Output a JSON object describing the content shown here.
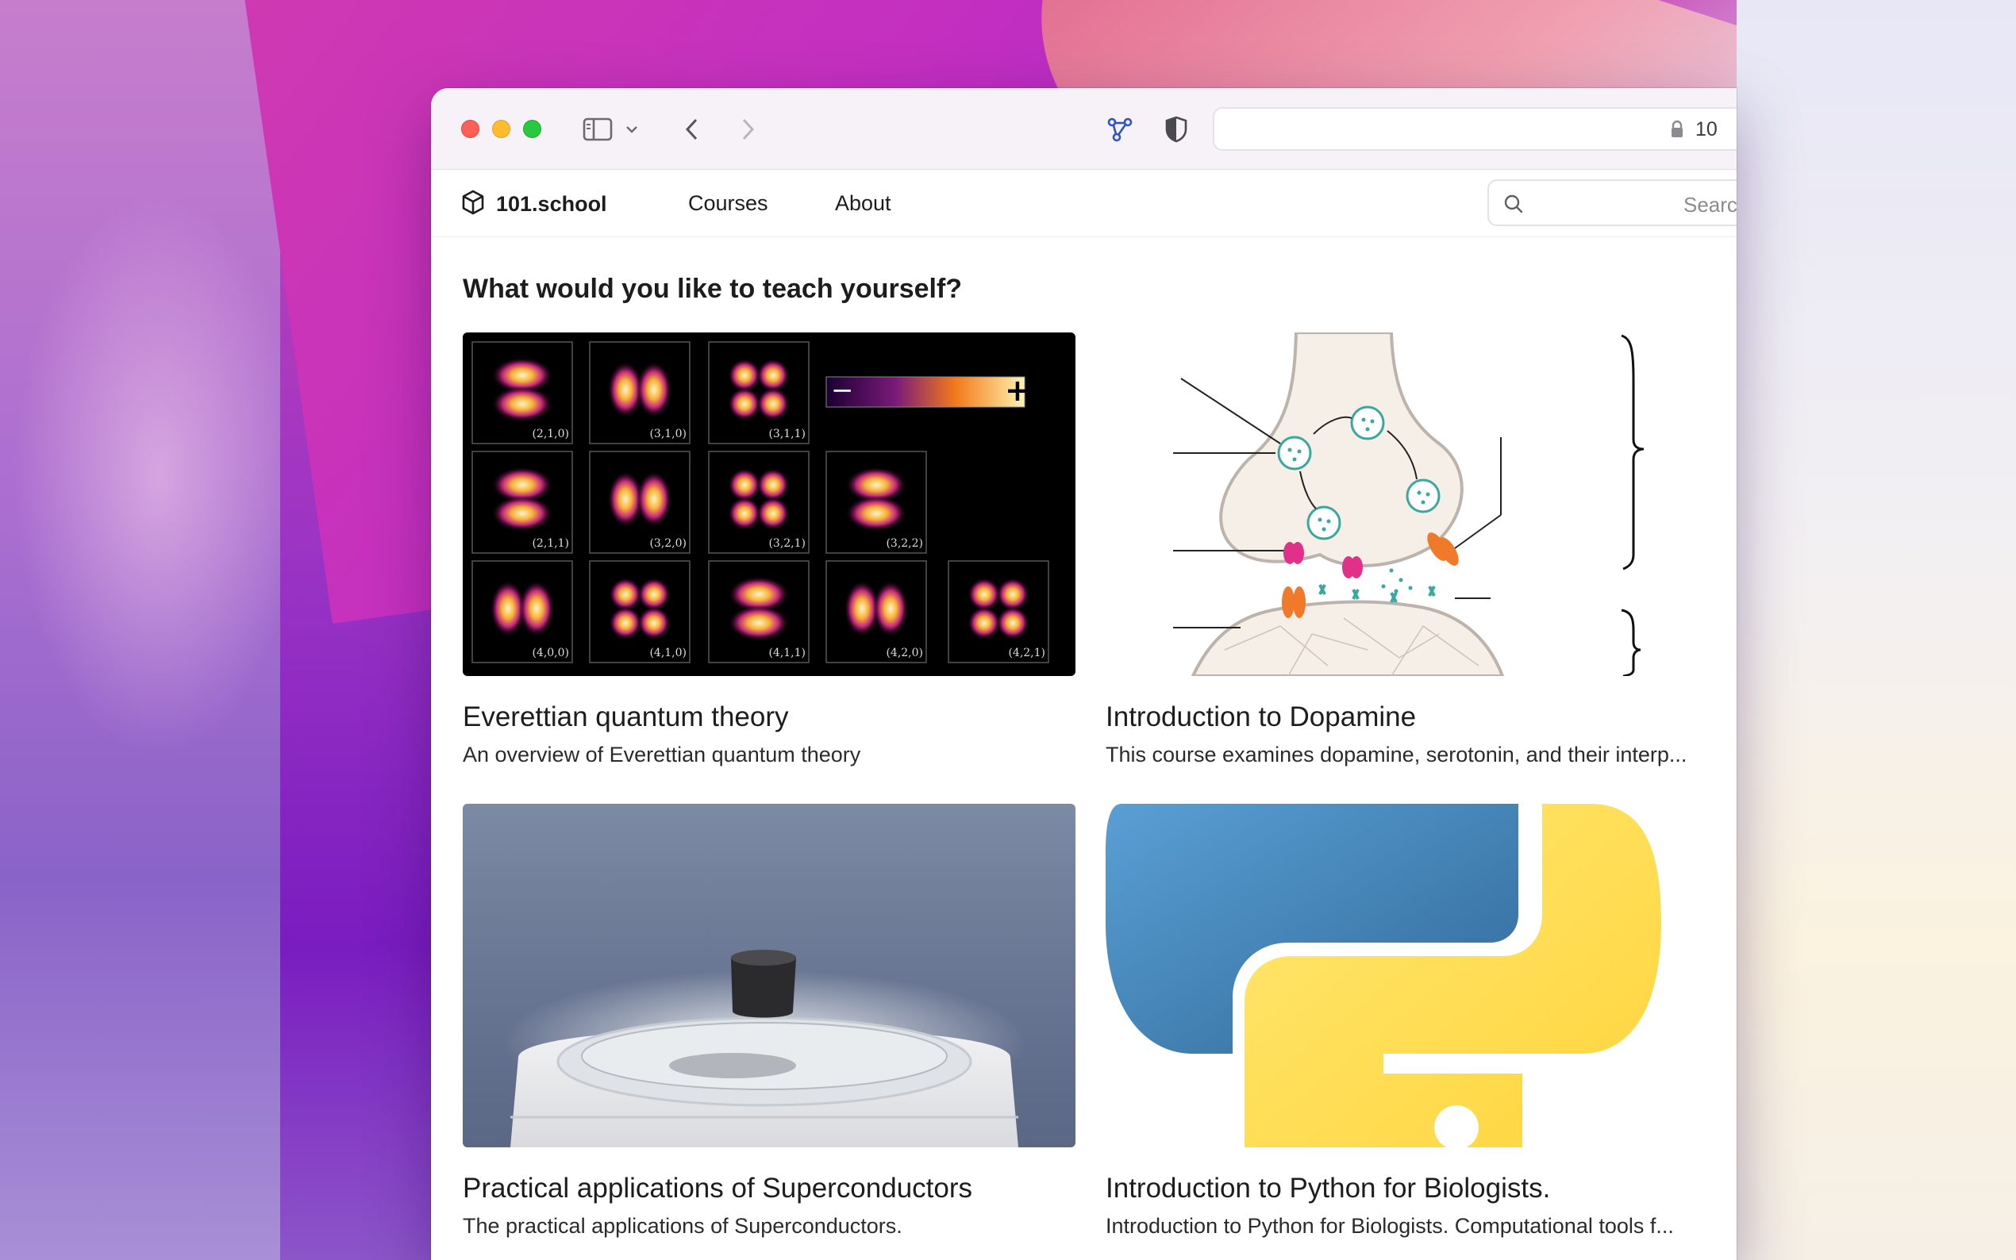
{
  "browser": {
    "url": "10",
    "controls": [
      "sidebar-toggle",
      "tab-overview",
      "back",
      "forward",
      "share-graph",
      "privacy-shield"
    ]
  },
  "site": {
    "brand": "101.school",
    "nav": [
      "Courses",
      "About"
    ],
    "search_placeholder": "Search"
  },
  "main": {
    "heading": "What would you like to teach yourself?",
    "courses": [
      {
        "title": "Everettian quantum theory",
        "description": "An overview of Everettian quantum theory",
        "image": "hydrogen-orbitals-image",
        "orbital_labels": [
          "(2,1,0)",
          "(3,1,0)",
          "(3,1,1)",
          "(2,1,1)",
          "(3,2,0)",
          "(3,2,1)",
          "(3,2,2)",
          "(4,0,0)",
          "(4,1,0)",
          "(4,1,1)",
          "(4,2,0)",
          "(4,2,1)"
        ],
        "colorbar_min": "−",
        "colorbar_max": "+"
      },
      {
        "title": "Introduction to Dopamine",
        "description": "This course examines dopamine, serotonin, and their interp...",
        "image": "synapse-diagram-image"
      },
      {
        "title": "Practical applications of Superconductors",
        "description": "The practical applications of Superconductors.",
        "image": "levitating-magnet-photo"
      },
      {
        "title": "Introduction to Python for Biologists.",
        "description": "Introduction to Python for Biologists. Computational tools f...",
        "image": "python-logo-image"
      }
    ]
  },
  "colors": {
    "text": "#1d1d1f",
    "titlebar": "#f6f2f7",
    "python_blue": "#3a6ea5",
    "python_yellow": "#ffd343",
    "orbital_glow": "#f5a623"
  }
}
